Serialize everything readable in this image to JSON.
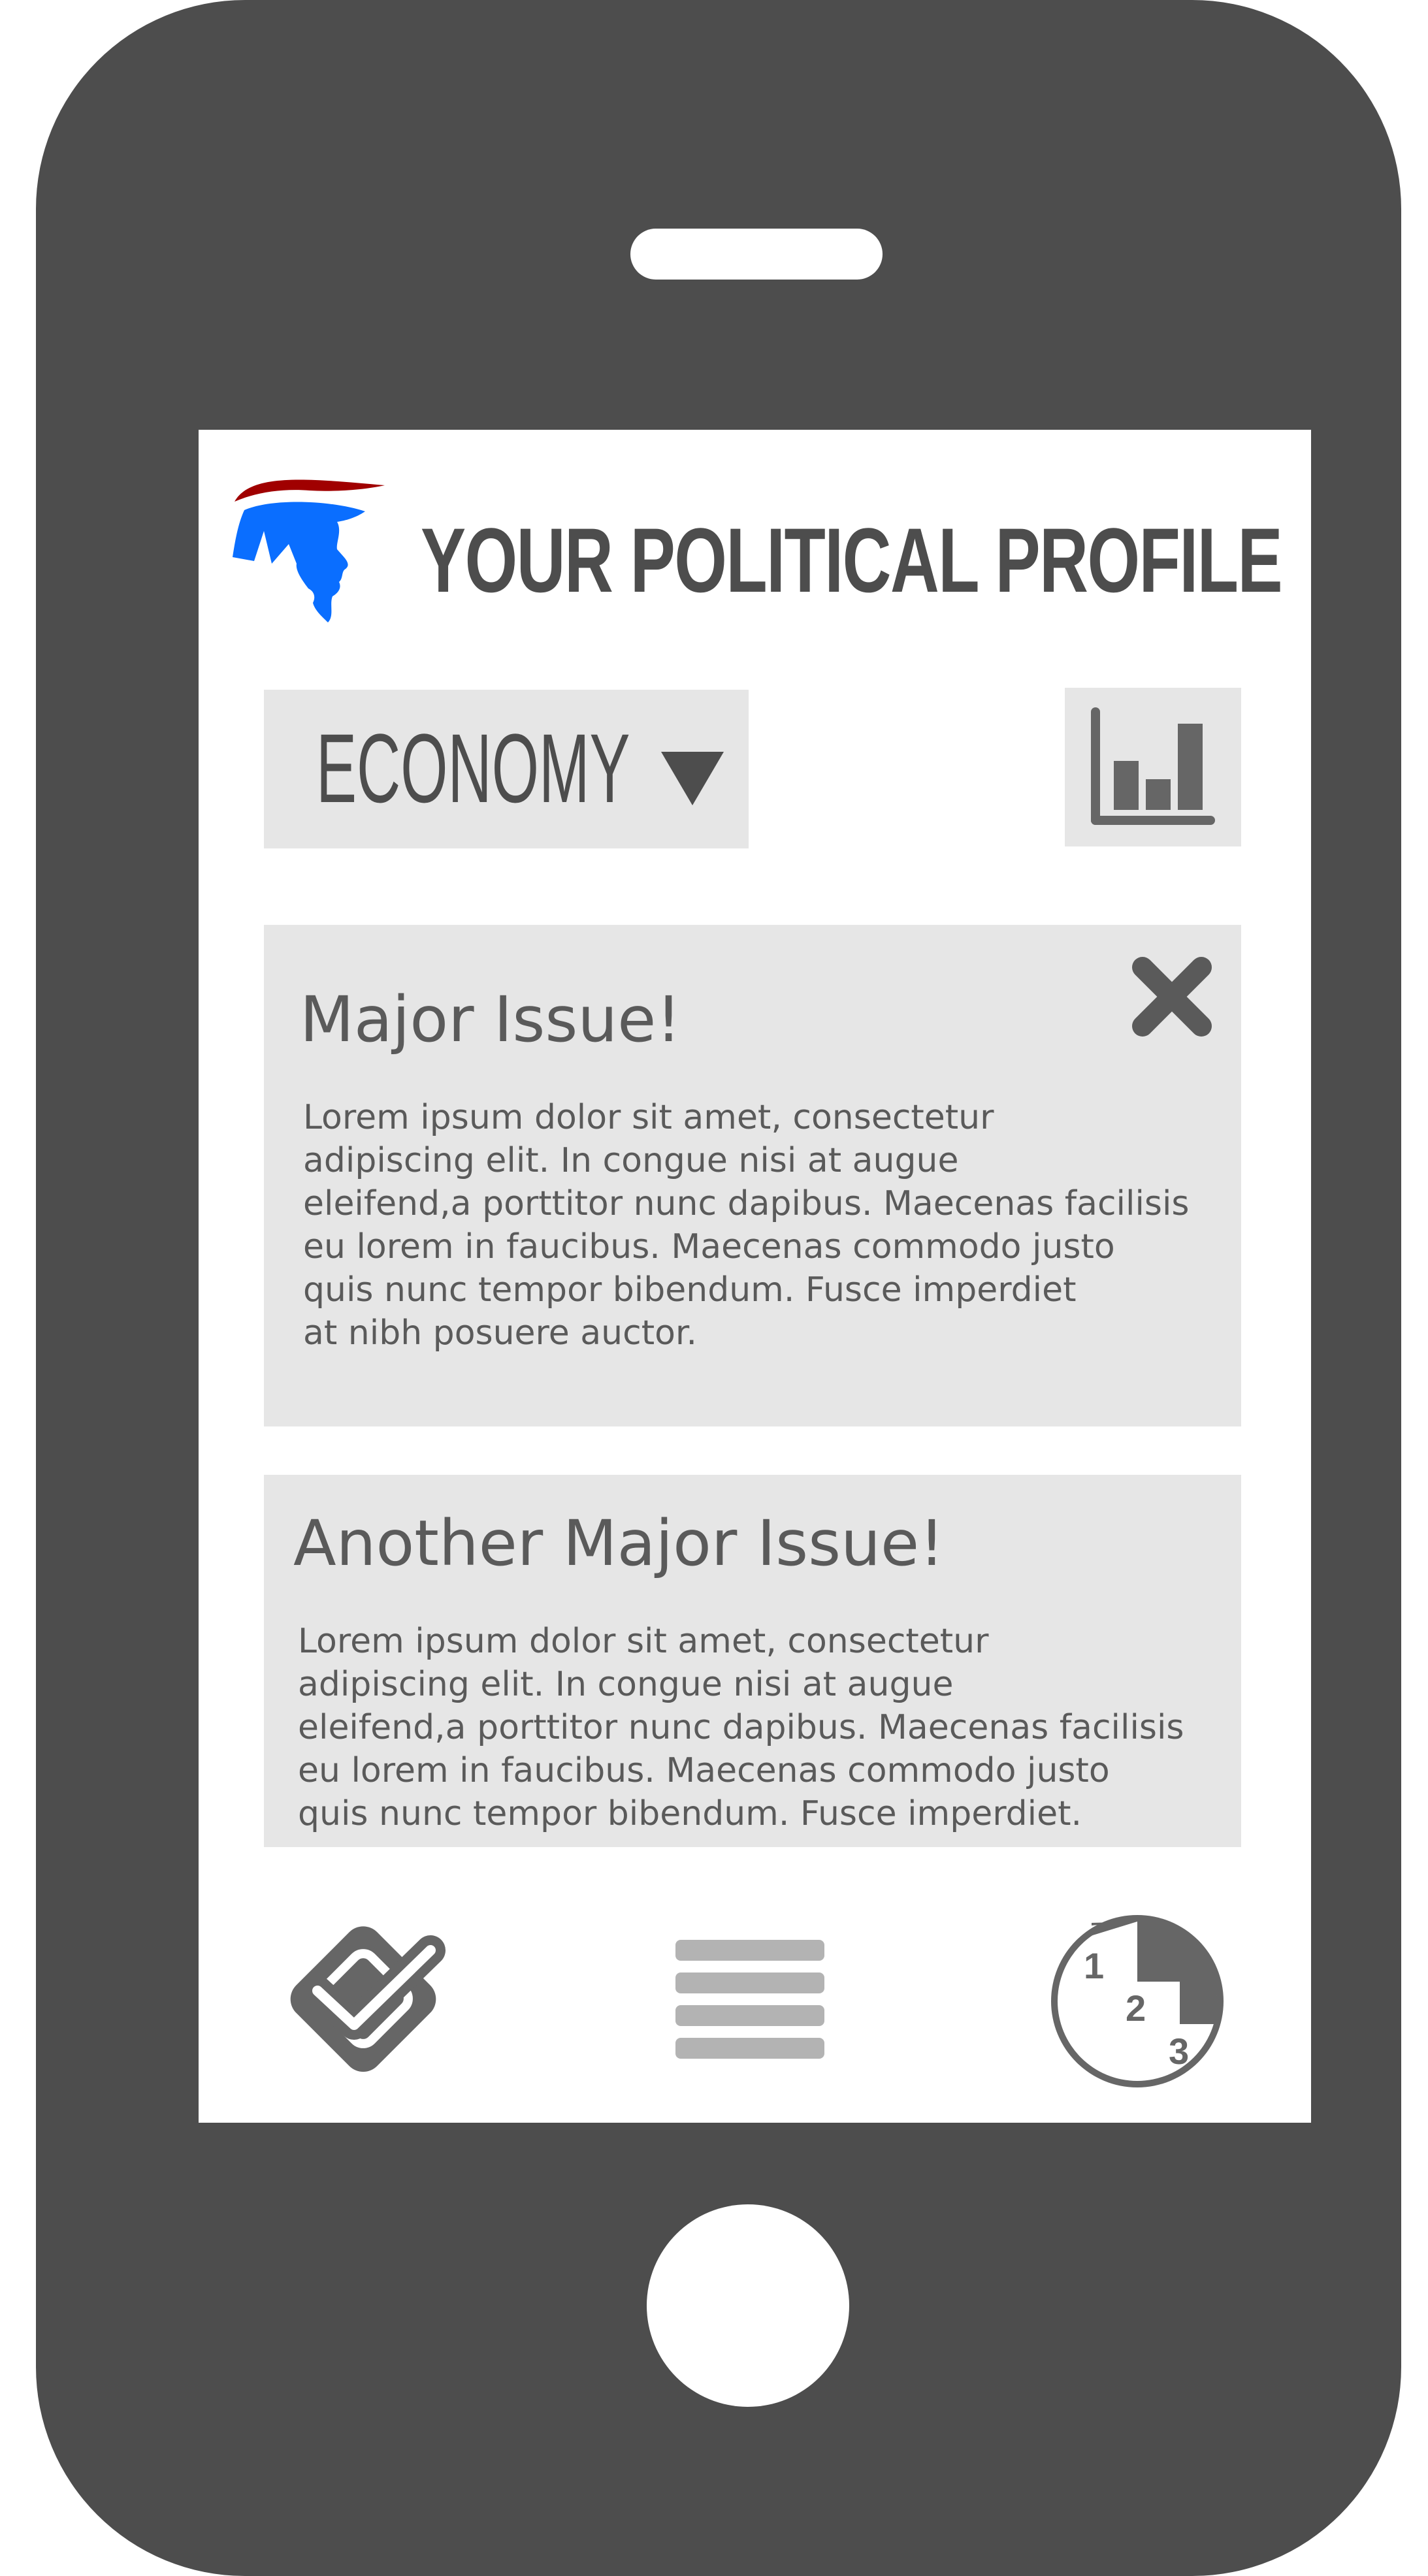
{
  "header": {
    "title": "YOUR POLITICAL PROFILE",
    "logo_icon": "patriot-head-logo"
  },
  "filter": {
    "category": "ECONOMY",
    "dropdown_icon": "triangle-down-icon"
  },
  "toolbar": {
    "stats_icon": "bar-chart-icon"
  },
  "issues": [
    {
      "title": "Major Issue!",
      "body": "Lorem ipsum dolor sit amet, consectetur\nadipiscing elit. In congue nisi at augue\neleifend,a porttitor nunc dapibus. Maecenas facilisis\neu lorem in faucibus. Maecenas commodo justo\nquis nunc tempor bibendum. Fusce imperdiet\nat nibh posuere auctor.",
      "close_icon": "close-icon"
    },
    {
      "title": "Another Major Issue!",
      "body": "Lorem ipsum dolor sit amet, consectetur\nadipiscing elit. In congue nisi at augue\neleifend,a porttitor nunc dapibus. Maecenas facilisis\neu lorem in faucibus. Maecenas commodo justo\nquis nunc tempor bibendum. Fusce imperdiet."
    }
  ],
  "bottom_nav": {
    "check_icon": "checklist-icon",
    "menu_icon": "hamburger-menu-icon",
    "rank_icon": "ranking-podium-icon",
    "rank_numbers": [
      "1",
      "2",
      "3"
    ]
  },
  "colors": {
    "device": "#4d4d4d",
    "panel": "#e6e6e6",
    "text": "#5a5a5a",
    "logo_blue": "#0a6eff",
    "logo_red": "#a00000"
  }
}
